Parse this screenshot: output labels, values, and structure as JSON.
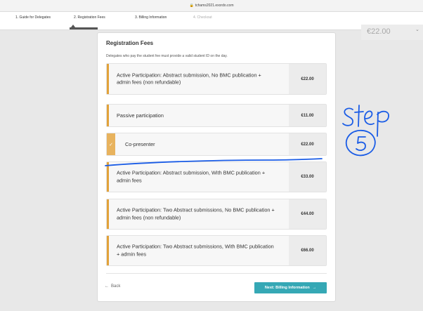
{
  "browser": {
    "url": "tchams2021.exordo.com"
  },
  "steps": [
    {
      "label": "1. Guide for Delegates"
    },
    {
      "label": "2. Registration Fees"
    },
    {
      "label": "3. Billing Information"
    },
    {
      "label": "4. Checkout"
    }
  ],
  "summary": {
    "total": "€22.00"
  },
  "card": {
    "title": "Registration Fees",
    "note": "Delegates who pay the student fee must provide a valid student ID on the day.",
    "options": [
      {
        "label": "Active Participation: Abstract submission, No BMC publication + admin fees (non refundable)",
        "price": "€22.00",
        "selected": false
      },
      {
        "label": "Passive participation",
        "price": "€11.00",
        "selected": false
      },
      {
        "label": "Co-presenter",
        "price": "€22.00",
        "selected": true
      },
      {
        "label": "Active Participation: Abstract submission, With BMC publication + admin fees",
        "price": "€33.00",
        "selected": false
      },
      {
        "label": "Active Participation: Two Abstract submissions, No BMC publication + admin fees (non refundable)",
        "price": "€44.00",
        "selected": false
      },
      {
        "label": "Active Participation: Two Abstract submissions, With BMC publication + admin fees",
        "price": "€66.00",
        "selected": false
      }
    ],
    "back_label": "Back",
    "next_label": "Next: Billing Information"
  },
  "annotation": {
    "word": "step",
    "number": "5",
    "ink_color": "#1a5ce6"
  },
  "colors": {
    "accent": "#e2a23a",
    "primary_button": "#35a8b5"
  }
}
